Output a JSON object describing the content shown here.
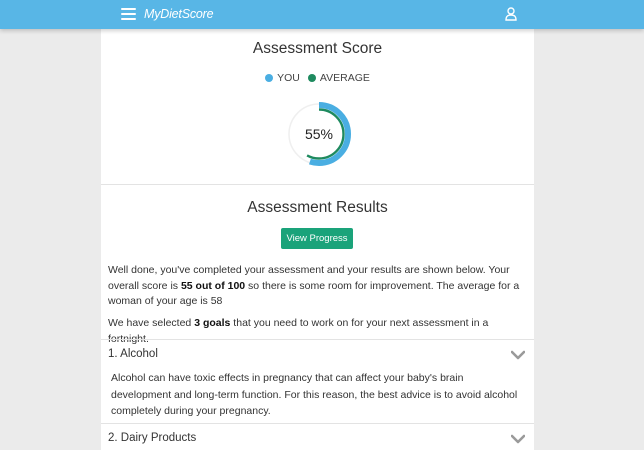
{
  "header": {
    "app_name": "MyDietScore",
    "bg_color": "#58b6e6"
  },
  "score": {
    "title": "Assessment Score",
    "legend": [
      {
        "label": "YOU",
        "color": "#4aaee2"
      },
      {
        "label": "AVERAGE",
        "color": "#1e8a5f"
      }
    ],
    "value_label": "55%",
    "you_percent": 55,
    "average_percent": 58
  },
  "results": {
    "title": "Assessment Results",
    "button_label": "View Progress",
    "button_color": "#1aa37a",
    "para1_part1": "Well done, you've completed your assessment and your results are shown below. Your overall score is ",
    "para1_bold": "55 out of 100",
    "para1_part2": " so there is some room for improvement. The average for a woman of your age is 58",
    "para2_part1": "We have selected ",
    "para2_bold": "3 goals",
    "para2_part2": " that you need to work on for your next assessment in a fortnight."
  },
  "goals": [
    {
      "title": "1. Alcohol",
      "body": "Alcohol can have toxic effects in pregnancy that can affect your baby's brain development and long-term function. For this reason, the best advice is to avoid alcohol completely during your pregnancy."
    },
    {
      "title": "2. Dairy Products"
    }
  ],
  "icons": {
    "menu": "hamburger-icon",
    "user": "user-icon",
    "expand": "chevron-down-icon"
  }
}
